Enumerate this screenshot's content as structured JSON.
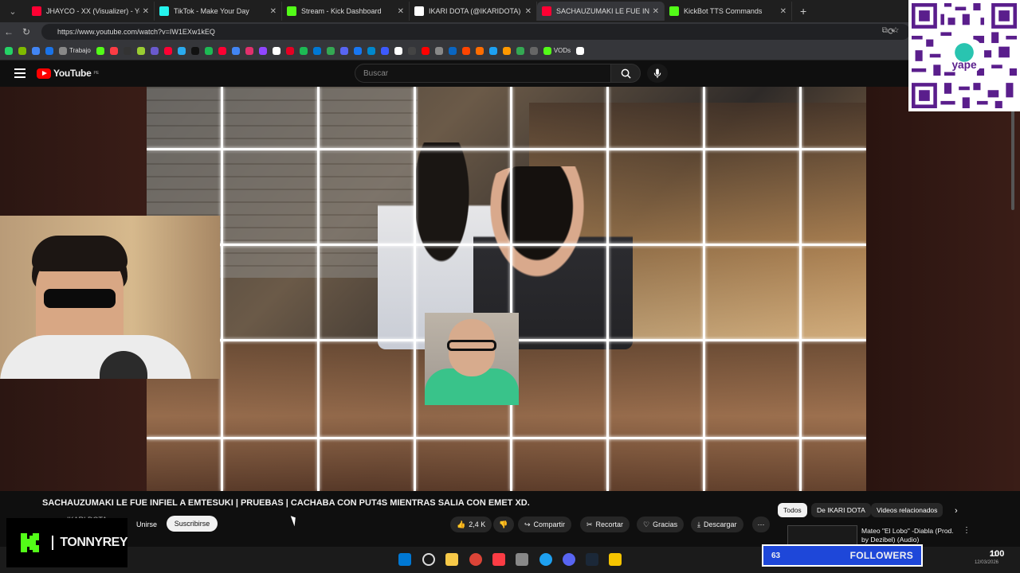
{
  "browser": {
    "tabs": [
      {
        "title": "JHAYCO - XX (Visualizer) - YouTube",
        "color": "#ff0033",
        "active": false
      },
      {
        "title": "TikTok - Make Your Day",
        "color": "#25f4ee",
        "active": false
      },
      {
        "title": "Stream - Kick Dashboard",
        "color": "#53fc18",
        "active": false
      },
      {
        "title": "IKARI DOTA (@IKARIDOTA) / X",
        "color": "#ffffff",
        "active": false
      },
      {
        "title": "SACHAUZUMAKI LE FUE INFIEL",
        "color": "#ff0033",
        "active": true
      },
      {
        "title": "KickBot TTS Commands",
        "color": "#53fc18",
        "active": false
      }
    ],
    "url": "https://www.youtube.com/watch?v=IW1EXw1kEQ",
    "bookmarks": [
      {
        "label": "",
        "color": "#25d366"
      },
      {
        "label": "",
        "color": "#7fba00"
      },
      {
        "label": "",
        "color": "#4285f4"
      },
      {
        "label": "",
        "color": "#1a73e8"
      },
      {
        "label": "Trabajo",
        "color": "#888888"
      },
      {
        "label": "",
        "color": "#53fc18"
      },
      {
        "label": "",
        "color": "#fc3c44"
      },
      {
        "label": "",
        "color": "#333333"
      },
      {
        "label": "",
        "color": "#9acd32"
      },
      {
        "label": "",
        "color": "#6a5acd"
      },
      {
        "label": "",
        "color": "#ff0033"
      },
      {
        "label": "",
        "color": "#2aabee"
      },
      {
        "label": "",
        "color": "#111111"
      },
      {
        "label": "",
        "color": "#1db954"
      },
      {
        "label": "",
        "color": "#ff0033"
      },
      {
        "label": "",
        "color": "#4285f4"
      },
      {
        "label": "",
        "color": "#e1306c"
      },
      {
        "label": "",
        "color": "#9146ff"
      },
      {
        "label": "",
        "color": "#ffffff"
      },
      {
        "label": "",
        "color": "#e60023"
      },
      {
        "label": "",
        "color": "#1db954"
      },
      {
        "label": "",
        "color": "#0078d4"
      },
      {
        "label": "",
        "color": "#34a853"
      },
      {
        "label": "",
        "color": "#5865f2"
      },
      {
        "label": "",
        "color": "#1877f2"
      },
      {
        "label": "",
        "color": "#0088cc"
      },
      {
        "label": "",
        "color": "#3d5afe"
      },
      {
        "label": "",
        "color": "#ffffff"
      },
      {
        "label": "",
        "color": "#444444"
      },
      {
        "label": "",
        "color": "#ff0000"
      },
      {
        "label": "",
        "color": "#888888"
      },
      {
        "label": "",
        "color": "#0a66c2"
      },
      {
        "label": "",
        "color": "#ff4500"
      },
      {
        "label": "",
        "color": "#ff6d00"
      },
      {
        "label": "",
        "color": "#1da1f2"
      },
      {
        "label": "",
        "color": "#ff9900"
      },
      {
        "label": "",
        "color": "#34a853"
      },
      {
        "label": "",
        "color": "#666666"
      },
      {
        "label": "VODs",
        "color": "#53fc18"
      },
      {
        "label": "",
        "color": "#ffffff"
      }
    ]
  },
  "youtube": {
    "logo_text": "YouTube",
    "logo_region": "PE",
    "search_placeholder": "Buscar"
  },
  "video": {
    "title": "SACHAUZUMAKI LE FUE INFIEL A EMTESUKI | PRUEBAS | CACHABA CON PUT4S MIENTRAS SALIA CON EMET XD.",
    "channel": "IKARI DOTA",
    "join_label": "Unirse",
    "subscribe_label": "Suscribirse",
    "likes": "2,4 K",
    "actions": {
      "share": "Compartir",
      "clip": "Recortar",
      "thanks": "Gracias",
      "download": "Descargar"
    }
  },
  "sidebar": {
    "chips": [
      "Todos",
      "De IKARI DOTA",
      "Videos relacionados"
    ],
    "related_title": "Mateo \"El Lobo\" -Diabla (Prod. by Dezibel) (Audio)"
  },
  "overlay": {
    "streamer": "TONNYREY",
    "followers_count": "63",
    "followers_label": "FOLLOWERS",
    "followers_goal": "100",
    "qr_brand": "yape",
    "kick_color": "#53fc18",
    "followers_color": "#1e47d9"
  },
  "taskbar": {
    "time": "21:",
    "date": "12/03/2026"
  }
}
